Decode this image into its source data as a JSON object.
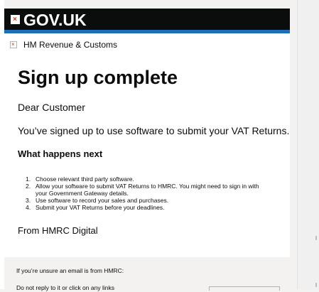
{
  "brand": {
    "logo_glyph": "×",
    "title": "GOV.UK"
  },
  "org": {
    "icon_glyph": "×",
    "name": "HM Revenue & Customs"
  },
  "email": {
    "heading": "Sign up complete",
    "greeting": "Dear Customer",
    "lead": "You’ve signed up to use software to submit your VAT Returns.",
    "subheading": "What happens next",
    "steps": [
      {
        "n": "1.",
        "text": "Choose relevant third party software."
      },
      {
        "n": "2.",
        "text": "Allow your software to submit VAT Returns to HMRC. You might need to sign in with your Government Gateway details."
      },
      {
        "n": "3.",
        "text": "Use software to record your sales and purchases."
      },
      {
        "n": "4.",
        "text": "Submit your VAT Returns before your deadlines."
      }
    ],
    "signoff": "From HMRC Digital"
  },
  "footer": {
    "unsure": "If you’re unsure an email is from HMRC:",
    "no_reply": "Do not reply to it or click on any links"
  },
  "colors": {
    "header_bg": "#0b0c0c",
    "accent_blue": "#1d70b8",
    "page_bg": "#f3f2f1"
  }
}
